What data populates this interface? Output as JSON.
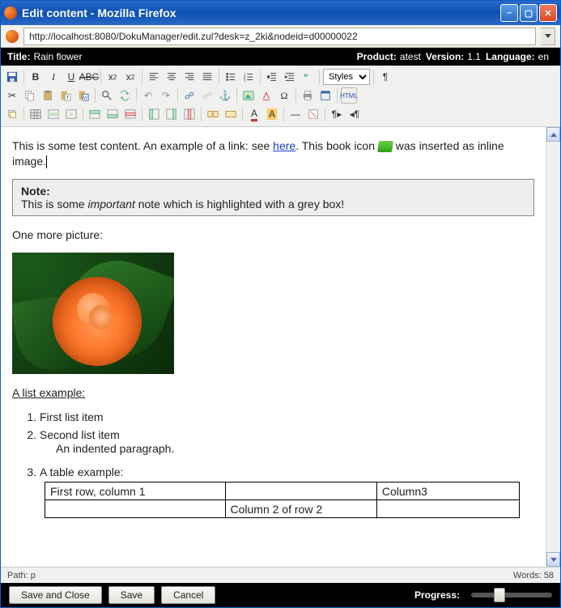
{
  "window": {
    "title": "Edit content - Mozilla Firefox"
  },
  "address": {
    "url": "http://localhost:8080/DokuManager/edit.zul?desk=z_2ki&nodeid=d00000022"
  },
  "meta": {
    "title_label": "Title:",
    "title_value": "Rain flower",
    "product_label": "Product:",
    "product_value": "atest",
    "version_label": "Version:",
    "version_value": "1.1",
    "language_label": "Language:",
    "language_value": "en"
  },
  "toolbar": {
    "styles_label": "Styles",
    "pilcrow": "¶"
  },
  "content": {
    "p1_a": "This is some test content. An example of a link: see ",
    "p1_link": "here",
    "p1_b": ". This book icon ",
    "p1_c": " was inserted as inline image.",
    "note_title": "Note:",
    "note_a": "This is some ",
    "note_em": "important",
    "note_b": " note which is highlighted with a grey box!",
    "p2": "One more picture:",
    "list_heading": "A list example:",
    "li1": "First list item",
    "li2": "Second list item",
    "li2_indent": "An indented paragraph.",
    "li3": "A table example:",
    "table": {
      "r1c1": "First row, column 1",
      "r1c2": "",
      "r1c3": "Column3",
      "r2c1": "",
      "r2c2": "Column 2 of row 2",
      "r2c3": ""
    }
  },
  "status": {
    "path_label": "Path:",
    "path_value": "p",
    "words_label": "Words:",
    "words_value": "58"
  },
  "buttons": {
    "save_close": "Save and Close",
    "save": "Save",
    "cancel": "Cancel",
    "progress": "Progress:"
  }
}
